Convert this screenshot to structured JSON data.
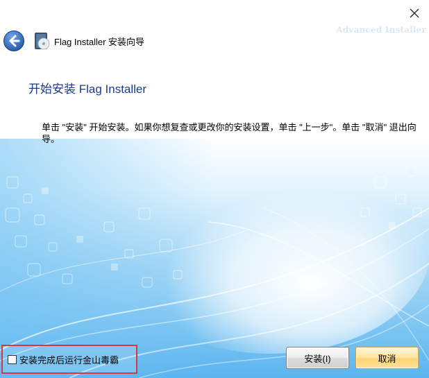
{
  "window": {
    "close_icon": "close-icon"
  },
  "header": {
    "back_icon": "back-arrow-icon",
    "app_icon": "installer-disc-icon",
    "title": "Flag Installer 安装向导",
    "watermark": "Advanced Installer"
  },
  "content": {
    "heading": "开始安装 Flag Installer",
    "description": "单击 \"安装\" 开始安装。如果你想复查或更改你的安装设置，单击 \"上一步\"。单击 \"取消\" 退出向导。"
  },
  "footer": {
    "checkbox_label": "安装完成后运行金山毒霸",
    "checkbox_checked": false,
    "install_label": "安装(I)",
    "cancel_label": "取消"
  },
  "colors": {
    "heading": "#1a3a8c",
    "back_button": "#2a5fb8",
    "highlight_border": "#d9363e",
    "cancel_button": "#ffd373"
  }
}
